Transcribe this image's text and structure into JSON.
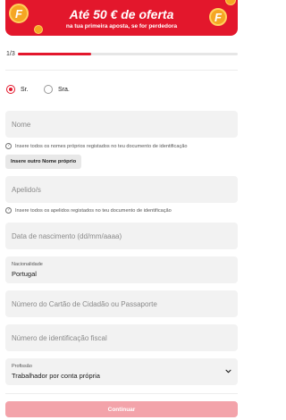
{
  "banner": {
    "title": "Até 50 € de oferta",
    "subtitle": "na tua primeira aposta, se for perdedora",
    "coin_letter": "F"
  },
  "progress": {
    "label": "1/3",
    "step": 1,
    "total": 3,
    "fraction": 0.333
  },
  "salutation": {
    "options": [
      {
        "label": "Sr.",
        "checked": true
      },
      {
        "label": "Sra.",
        "checked": false
      }
    ]
  },
  "form": {
    "first_name": {
      "placeholder": "Nome",
      "hint": "Insere todos os nomes próprios registados no teu documento de identificação",
      "add_button": "Insere outro Nome próprio"
    },
    "last_name": {
      "placeholder": "Apelido/s",
      "hint": "Insere todos os apelidos registados no teu documento de identificação"
    },
    "birth_date": {
      "placeholder": "Data de nascimento (dd/mm/aaaa)"
    },
    "nationality": {
      "label": "Nacionalidade",
      "value": "Portugal"
    },
    "id_number": {
      "placeholder": "Número do Cartão de Cidadão ou Passaporte"
    },
    "tax_id": {
      "placeholder": "Número de identificação fiscal"
    },
    "profession": {
      "label": "Profissão",
      "value": "Trabalhador por conta própria"
    }
  },
  "actions": {
    "continue_label": "Continuar"
  },
  "colors": {
    "brand_red": "#e3172c",
    "disabled_button": "#f3a3aa",
    "field_bg": "#f2f2f2"
  },
  "icons": [
    "coin-icon",
    "info-icon",
    "chevron-down-icon"
  ]
}
